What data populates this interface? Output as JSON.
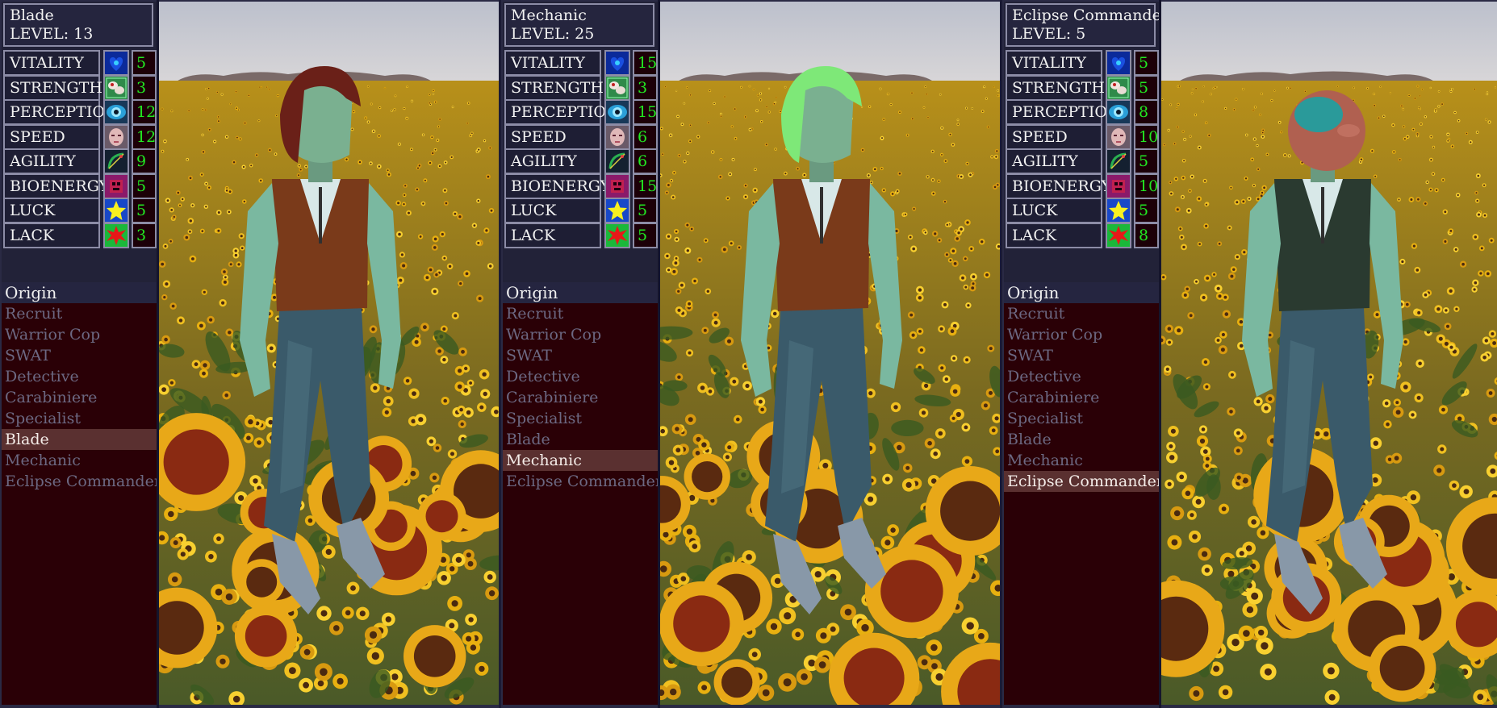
{
  "labels": {
    "level_prefix": "LEVEL: ",
    "origin_header": "Origin"
  },
  "stat_names": [
    "VITALITY",
    "STRENGTH",
    "PERCEPTION",
    "SPEED",
    "AGILITY",
    "BIOENERGY",
    "LUCK",
    "LACK"
  ],
  "stat_icons": [
    "heart-icon",
    "muscle-icon",
    "eye-icon",
    "face-icon",
    "bow-icon",
    "bioenergy-icon",
    "star-icon",
    "burst-icon"
  ],
  "origins": [
    "Recruit",
    "Warrior Cop",
    "SWAT",
    "Detective",
    "Carabiniere",
    "Specialist",
    "Blade",
    "Mechanic",
    "Eclipse Commander"
  ],
  "characters": [
    {
      "name": "Blade",
      "level": "13",
      "stats": [
        "5",
        "3",
        "12",
        "12",
        "9",
        "5",
        "5",
        "3"
      ],
      "selected_origin": "Blade",
      "hair": "dark-brown-hair",
      "head": "human"
    },
    {
      "name": "Mechanic",
      "level": "25",
      "stats": [
        "15",
        "3",
        "15",
        "6",
        "6",
        "15",
        "5",
        "5"
      ],
      "selected_origin": "Mechanic",
      "hair": "green-hair",
      "head": "human"
    },
    {
      "name": "Eclipse Commander",
      "level": "5",
      "stats": [
        "5",
        "5",
        "8",
        "10",
        "5",
        "10",
        "5",
        "8"
      ],
      "selected_origin": "Eclipse Commander",
      "hair": "teal-mask",
      "head": "mask"
    }
  ],
  "colors": {
    "stat_value": "#22e822",
    "selected_origin_bg": "#5a3030",
    "origin_list_bg": "#2a0006",
    "panel_border": "#8c8ca6"
  }
}
